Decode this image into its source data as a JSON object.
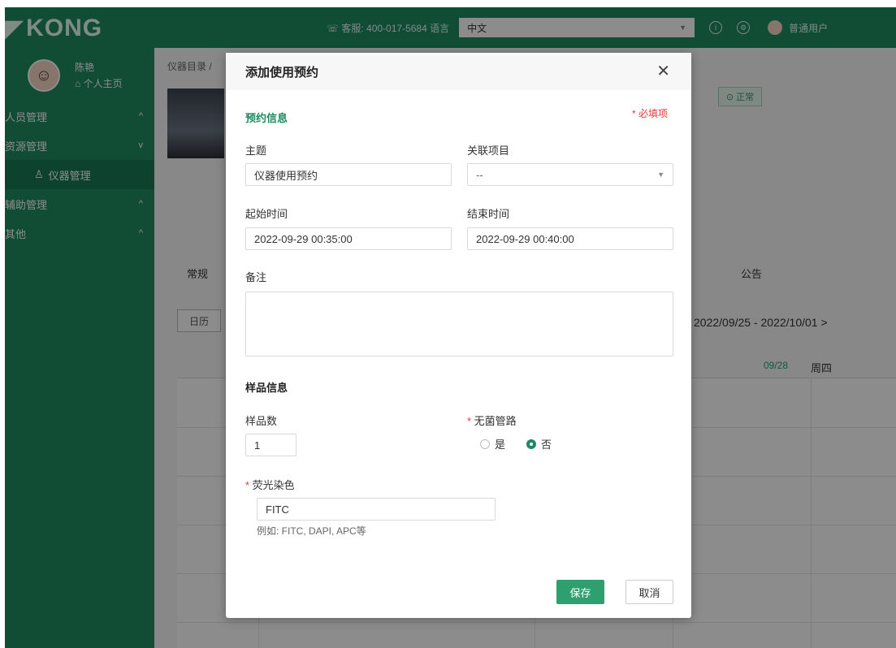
{
  "app": {
    "logo": "KONG",
    "service_text": "客服: 400-017-5684 语言",
    "language": "中文",
    "current_user": "普通用户"
  },
  "sidebar": {
    "user_name": "陈艳",
    "home_link": "个人主页",
    "items": [
      {
        "label": "人员管理",
        "caret": "^"
      },
      {
        "label": "资源管理",
        "caret": "v"
      },
      {
        "label": "仪器管理",
        "caret": ""
      },
      {
        "label": "辅助管理",
        "caret": "^"
      },
      {
        "label": "其他",
        "caret": "^"
      }
    ]
  },
  "background": {
    "breadcrumb": "仪器目录 /",
    "status": "正常",
    "tab_general": "常规",
    "tab_notice": "公告",
    "calendar_button": "日历",
    "week_range": "2022/09/25 - 2022/10/01  >",
    "col_date": "09/28",
    "col_thu": "周四"
  },
  "modal": {
    "title": "添加使用预约",
    "section_booking": "预约信息",
    "required_note": "* 必填项",
    "subject_label": "主题",
    "subject_value": "仪器使用预约",
    "project_label": "关联项目",
    "project_value": "--",
    "start_label": "起始时间",
    "start_value": "2022-09-29 00:35:00",
    "end_label": "结束时间",
    "end_value": "2022-09-29 00:40:00",
    "remark_label": "备注",
    "remark_value": "",
    "section_sample": "样品信息",
    "sample_count_label": "样品数",
    "sample_count_value": "1",
    "sterile_label": "无菌管路",
    "sterile_yes": "是",
    "sterile_no": "否",
    "stain_label": "荧光染色",
    "stain_value": "FITC",
    "stain_hint": "例如: FITC, DAPI, APC等",
    "save_label": "保存",
    "cancel_label": "取消"
  },
  "colors": {
    "brand": "#1f8a62",
    "primary_button": "#2ea06f",
    "required": "#e23b3b"
  }
}
